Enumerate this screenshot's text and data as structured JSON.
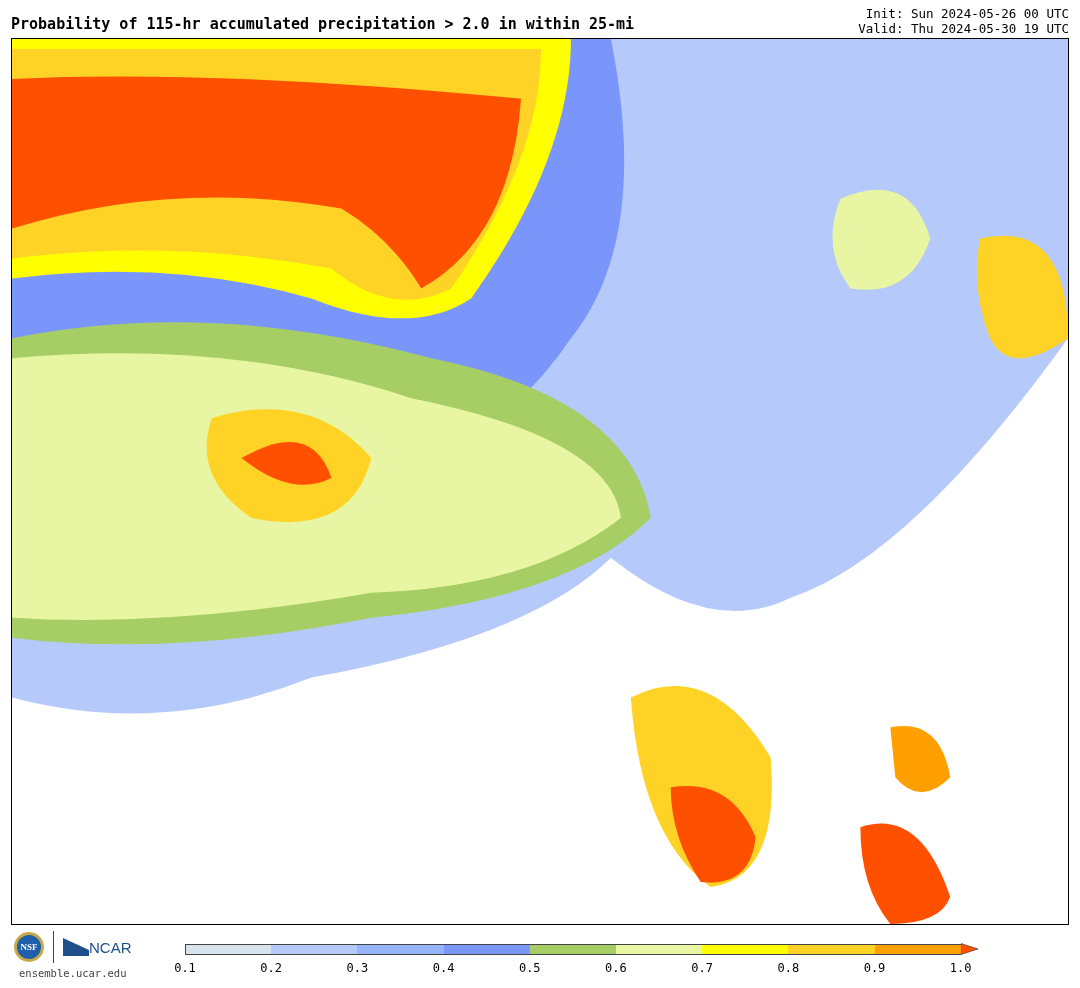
{
  "title": "Probability of 115-hr accumulated precipitation > 2.0 in within 25-mi",
  "run_info": [
    "Init: Sun 2024-05-26 00 UTC",
    "Valid: Thu 2024-05-30 19 UTC"
  ],
  "logos": {
    "nsf": "NSF",
    "ncar": "NCAR"
  },
  "site": "ensemble.ucar.edu",
  "colorbar": {
    "segments": [
      {
        "kind": "bar",
        "color": "#d7e3ee"
      },
      {
        "kind": "bar",
        "color": "#b5c9fb"
      },
      {
        "kind": "bar",
        "color": "#97b4fb"
      },
      {
        "kind": "bar",
        "color": "#7a96fa"
      },
      {
        "kind": "bar",
        "color": "#a6ce65"
      },
      {
        "kind": "bar",
        "color": "#e8f6a3"
      },
      {
        "kind": "bar",
        "color": "#ffff00"
      },
      {
        "kind": "bar",
        "color": "#ffd226"
      },
      {
        "kind": "bar",
        "color": "#ffa000"
      },
      {
        "kind": "arrow",
        "color": "#ff5000"
      }
    ],
    "ticks": [
      "0.1",
      "0.2",
      "0.3",
      "0.4",
      "0.5",
      "0.6",
      "0.7",
      "0.8",
      "0.9",
      "1.0"
    ]
  }
}
